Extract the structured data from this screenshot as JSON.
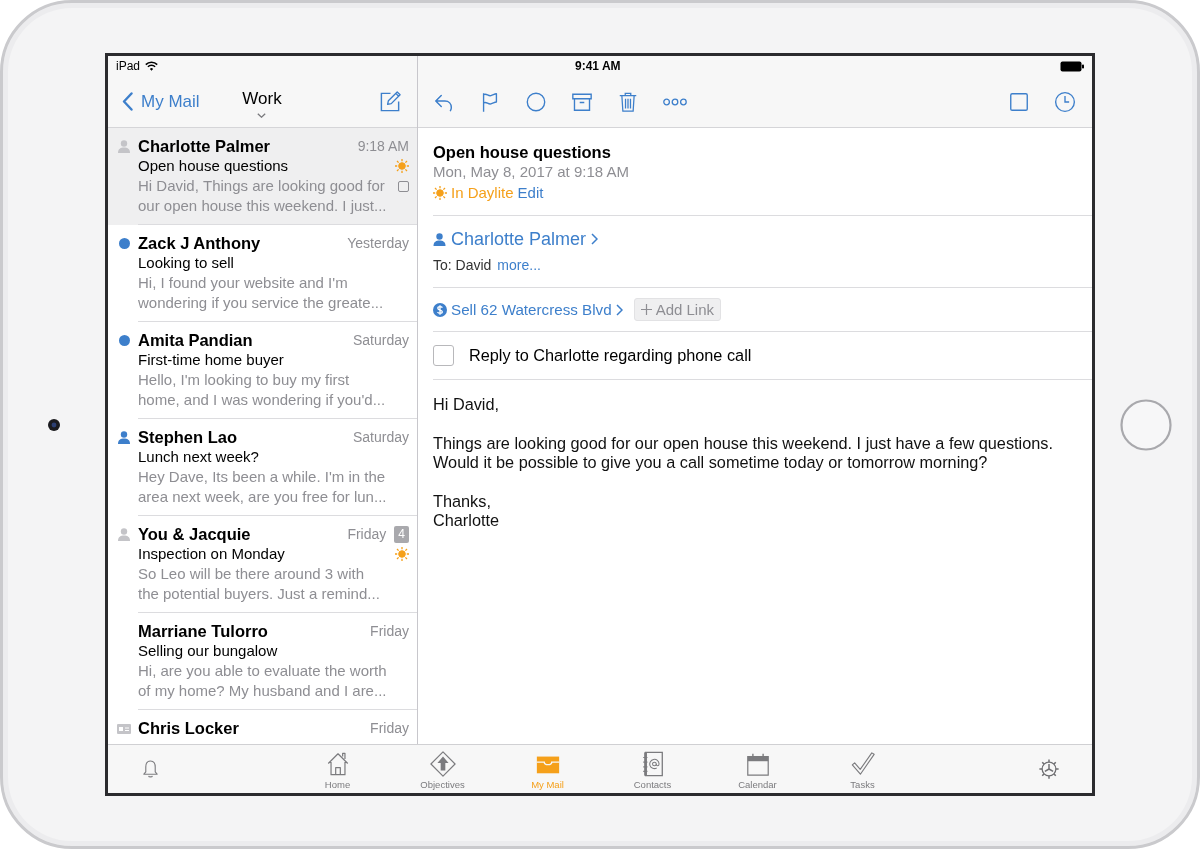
{
  "status_bar": {
    "device": "iPad",
    "time": "9:41 AM"
  },
  "mailbox_header": {
    "back": "My Mail",
    "title": "Work"
  },
  "messages": [
    {
      "sender": "Charlotte Palmer",
      "time": "9:18 AM",
      "subject": "Open house questions",
      "preview": "Hi David, Things are looking good for our open house this weekend. I just...",
      "selected": true,
      "unread": false,
      "kind": "contact",
      "in_daylite": true,
      "has_task": true
    },
    {
      "sender": "Zack J Anthony",
      "time": "Yesterday",
      "subject": "Looking to sell",
      "preview": "Hi, I found your website and I'm wondering if you service the greate...",
      "selected": false,
      "unread": true,
      "kind": "none",
      "in_daylite": false,
      "has_task": false
    },
    {
      "sender": "Amita Pandian",
      "time": "Saturday",
      "subject": "First-time home buyer",
      "preview": "Hello, I'm looking to buy my first home, and I was wondering if you'd...",
      "selected": false,
      "unread": true,
      "kind": "none",
      "in_daylite": false,
      "has_task": false
    },
    {
      "sender": "Stephen Lao",
      "time": "Saturday",
      "subject": "Lunch next week?",
      "preview": "Hey Dave, Its been a while. I'm in the area next week, are you free for lun...",
      "selected": false,
      "unread": true,
      "kind": "contact",
      "in_daylite": false,
      "has_task": false
    },
    {
      "sender": "You & Jacquie",
      "time": "Friday",
      "count": "4",
      "subject": "Inspection on Monday",
      "preview": "So Leo will be there around 3 with the potential buyers. Just a remind...",
      "selected": false,
      "unread": false,
      "kind": "contact",
      "in_daylite": true,
      "has_task": false
    },
    {
      "sender": "Marriane Tulorro",
      "time": "Friday",
      "subject": "Selling our bungalow",
      "preview": "Hi, are you able to evaluate the worth of my home? My husband and I are...",
      "selected": false,
      "unread": false,
      "kind": "none",
      "in_daylite": false,
      "has_task": false
    },
    {
      "sender": "Chris Locker",
      "time": "Friday",
      "selected": false,
      "unread": false,
      "kind": "card",
      "in_daylite": false,
      "has_task": false
    }
  ],
  "message": {
    "subject": "Open house questions",
    "date": "Mon, May 8, 2017 at 9:18 AM",
    "daylite_status": "In Daylite",
    "edit": "Edit",
    "from": "Charlotte Palmer",
    "to": "To: David",
    "more": "more...",
    "links": [
      {
        "label": "Sell 62 Watercress Blvd"
      }
    ],
    "add_link": "Add Link",
    "task": {
      "label": "Reply to Charlotte regarding phone call",
      "checked": false
    },
    "body": [
      "Hi David,",
      "Things are looking good for our open house this weekend. I just have a few questions. Would it be possible to give you a call sometime today or tomorrow morning?",
      "Thanks,\nCharlotte"
    ]
  },
  "tab_bar": {
    "items": [
      {
        "label": "Home",
        "selected": false
      },
      {
        "label": "Objectives",
        "selected": false
      },
      {
        "label": "My Mail",
        "selected": true
      },
      {
        "label": "Contacts",
        "selected": false
      },
      {
        "label": "Calendar",
        "selected": false
      },
      {
        "label": "Tasks",
        "selected": false
      }
    ]
  }
}
